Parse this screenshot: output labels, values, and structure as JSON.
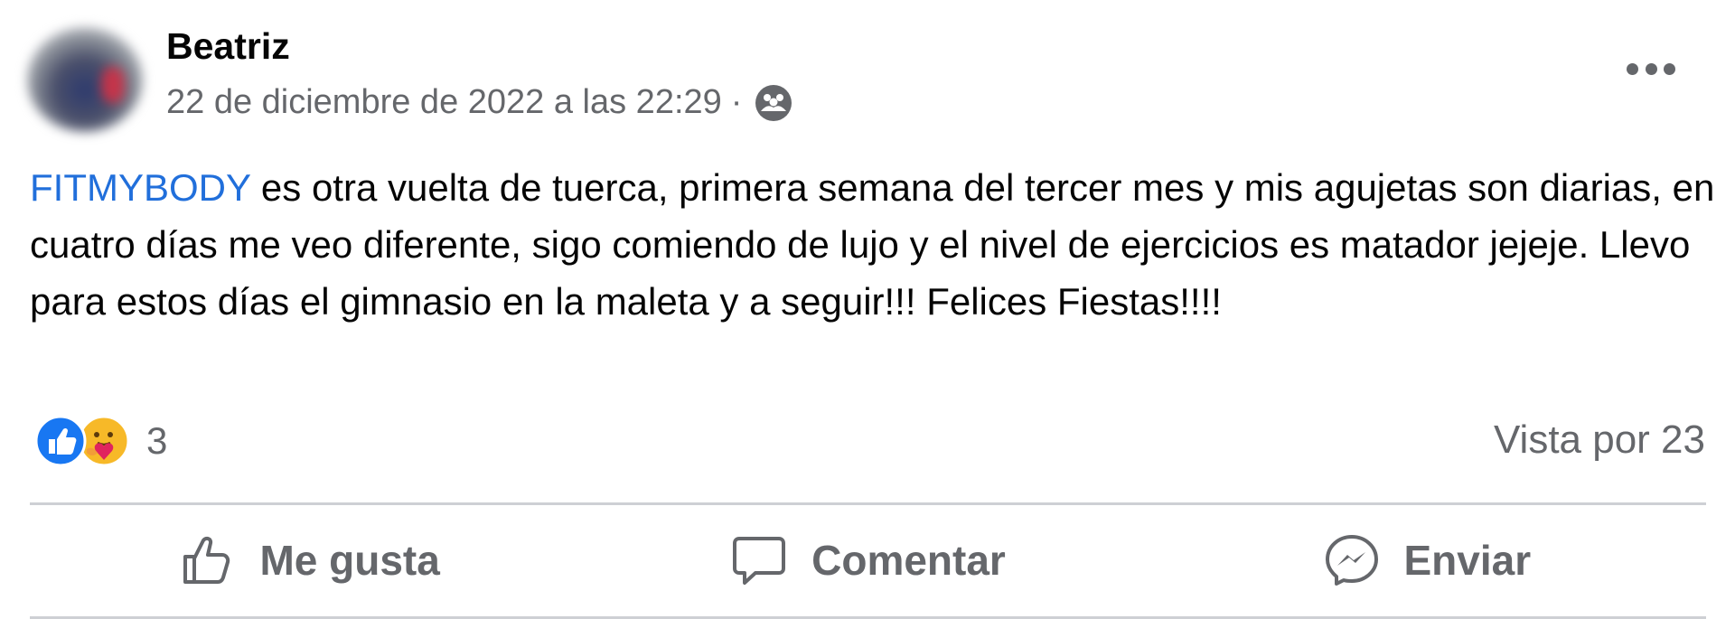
{
  "post": {
    "author": "Beatriz",
    "timestamp": "22 de diciembre de 2022 a las 22:29",
    "separator": "·",
    "audience_icon": "friends-icon",
    "text_tag": "FITMYBODY",
    "text_body": " es otra vuelta de tuerca,  primera semana del tercer mes y mis agujetas son diarias, en cuatro días me veo diferente, sigo comiendo de lujo y el nivel de ejercicios es matador jejeje. Llevo para estos días el gimnasio en la maleta y a seguir!!! Felices Fiestas!!!!"
  },
  "reactions": {
    "types": [
      "like",
      "care"
    ],
    "count": "3"
  },
  "views": "Vista por 23",
  "actions": {
    "like": "Me gusta",
    "comment": "Comentar",
    "send": "Enviar"
  },
  "colors": {
    "accent": "#216fdb",
    "secondary_text": "#65676b",
    "like_blue": "#1877f2",
    "care_yellow": "#f7b928"
  }
}
